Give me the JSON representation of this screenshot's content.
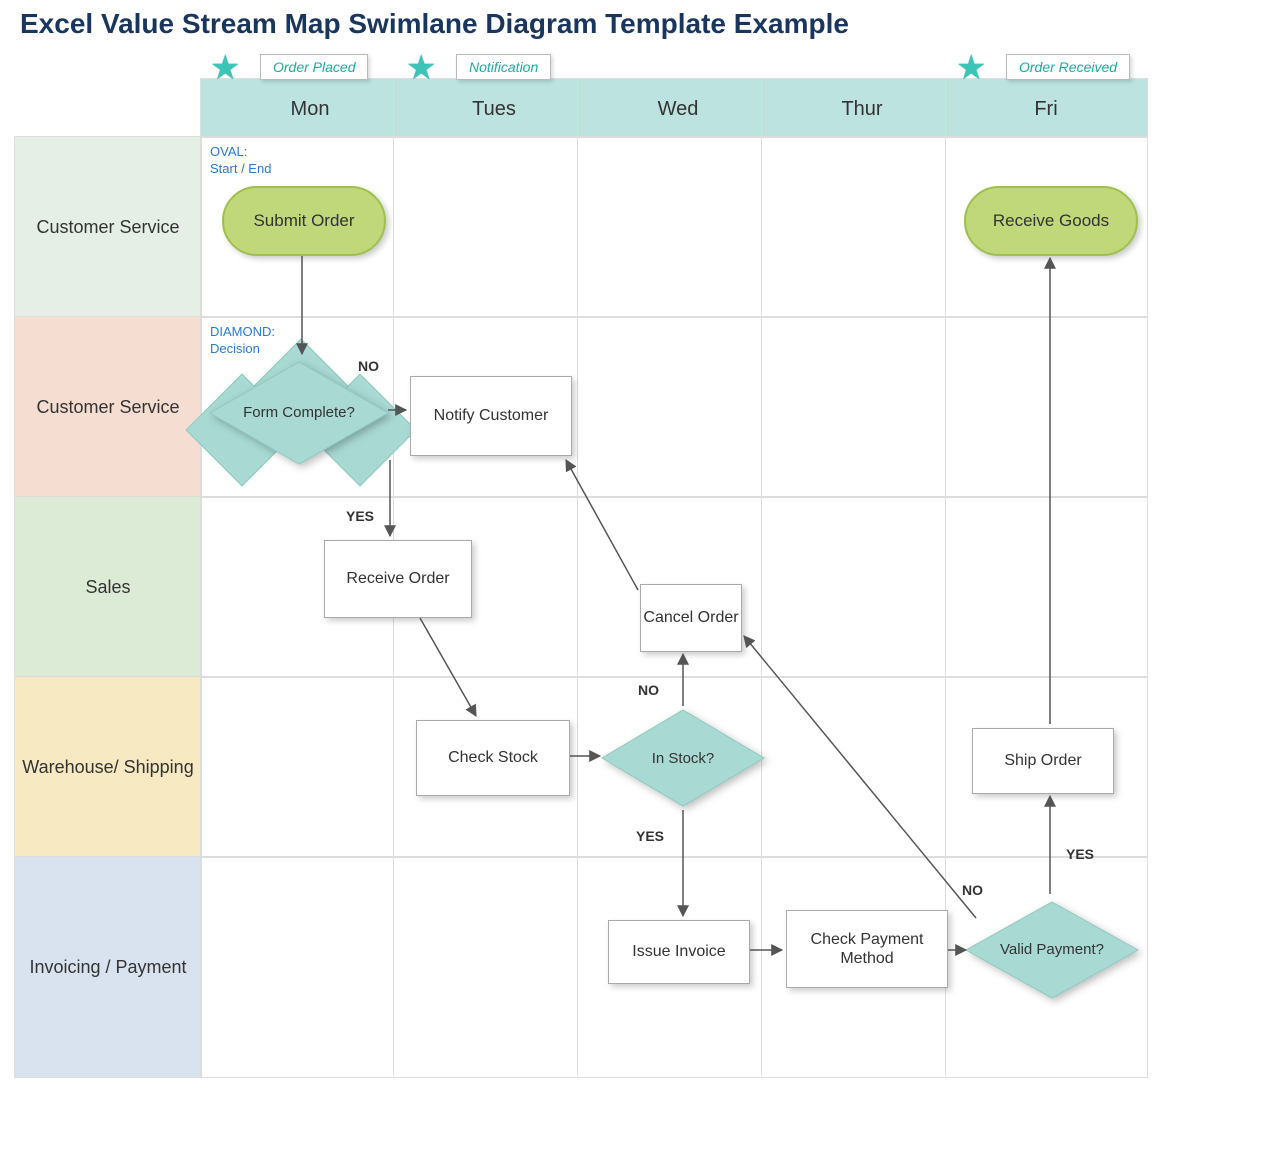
{
  "title": "Excel Value Stream Map Swimlane Diagram Template Example",
  "days": [
    "Mon",
    "Tues",
    "Wed",
    "Thur",
    "Fri"
  ],
  "milestones": [
    {
      "label": "Order Placed"
    },
    {
      "label": "Notification"
    },
    {
      "label": "Order Received"
    }
  ],
  "lanes": [
    {
      "name": "Customer Service"
    },
    {
      "name": "Customer Service"
    },
    {
      "name": "Sales"
    },
    {
      "name": "Warehouse/ Shipping"
    },
    {
      "name": "Invoicing / Payment"
    }
  ],
  "annotations": {
    "oval": "OVAL:\nStart / End",
    "diamond": "DIAMOND:\nDecision"
  },
  "nodes": {
    "submit_order": "Submit Order",
    "receive_goods": "Receive Goods",
    "form_complete": "Form Complete?",
    "notify_customer": "Notify Customer",
    "receive_order": "Receive Order",
    "check_stock": "Check Stock",
    "in_stock": "In Stock?",
    "cancel_order": "Cancel Order",
    "ship_order": "Ship Order",
    "issue_invoice": "Issue Invoice",
    "check_payment": "Check Payment Method",
    "valid_payment": "Valid Payment?"
  },
  "edge_labels": {
    "no1": "NO",
    "yes1": "YES",
    "no2": "NO",
    "yes2": "YES",
    "no3": "NO",
    "yes3": "YES"
  },
  "chart_data": {
    "type": "swimlane-flowchart",
    "columns": [
      "Mon",
      "Tues",
      "Wed",
      "Thur",
      "Fri"
    ],
    "milestones": [
      {
        "label": "Order Placed",
        "column": "Mon"
      },
      {
        "label": "Notification",
        "column": "Tues"
      },
      {
        "label": "Order Received",
        "column": "Fri"
      }
    ],
    "lanes": [
      "Customer Service",
      "Customer Service",
      "Sales",
      "Warehouse/ Shipping",
      "Invoicing / Payment"
    ],
    "nodes": [
      {
        "id": "submit_order",
        "label": "Submit Order",
        "shape": "terminator",
        "lane": 0,
        "column": "Mon"
      },
      {
        "id": "form_complete",
        "label": "Form Complete?",
        "shape": "decision",
        "lane": 1,
        "column": "Mon"
      },
      {
        "id": "notify_customer",
        "label": "Notify Customer",
        "shape": "process",
        "lane": 1,
        "column": "Tues"
      },
      {
        "id": "receive_order",
        "label": "Receive Order",
        "shape": "process",
        "lane": 2,
        "column": "Mon/Tues"
      },
      {
        "id": "check_stock",
        "label": "Check Stock",
        "shape": "process",
        "lane": 3,
        "column": "Tues"
      },
      {
        "id": "in_stock",
        "label": "In Stock?",
        "shape": "decision",
        "lane": 3,
        "column": "Wed"
      },
      {
        "id": "cancel_order",
        "label": "Cancel Order",
        "shape": "process",
        "lane": 2,
        "column": "Wed"
      },
      {
        "id": "issue_invoice",
        "label": "Issue Invoice",
        "shape": "process",
        "lane": 4,
        "column": "Wed"
      },
      {
        "id": "check_payment",
        "label": "Check Payment Method",
        "shape": "process",
        "lane": 4,
        "column": "Thur"
      },
      {
        "id": "valid_payment",
        "label": "Valid Payment?",
        "shape": "decision",
        "lane": 4,
        "column": "Fri"
      },
      {
        "id": "ship_order",
        "label": "Ship Order",
        "shape": "process",
        "lane": 3,
        "column": "Fri"
      },
      {
        "id": "receive_goods",
        "label": "Receive Goods",
        "shape": "terminator",
        "lane": 0,
        "column": "Fri"
      }
    ],
    "edges": [
      {
        "from": "submit_order",
        "to": "form_complete"
      },
      {
        "from": "form_complete",
        "to": "notify_customer",
        "label": "NO"
      },
      {
        "from": "form_complete",
        "to": "receive_order",
        "label": "YES"
      },
      {
        "from": "receive_order",
        "to": "check_stock"
      },
      {
        "from": "check_stock",
        "to": "in_stock"
      },
      {
        "from": "in_stock",
        "to": "cancel_order",
        "label": "NO"
      },
      {
        "from": "cancel_order",
        "to": "notify_customer"
      },
      {
        "from": "in_stock",
        "to": "issue_invoice",
        "label": "YES"
      },
      {
        "from": "issue_invoice",
        "to": "check_payment"
      },
      {
        "from": "check_payment",
        "to": "valid_payment"
      },
      {
        "from": "valid_payment",
        "to": "cancel_order",
        "label": "NO"
      },
      {
        "from": "valid_payment",
        "to": "ship_order",
        "label": "YES"
      },
      {
        "from": "ship_order",
        "to": "receive_goods"
      }
    ],
    "legend": [
      {
        "shape": "oval",
        "meaning": "Start / End"
      },
      {
        "shape": "diamond",
        "meaning": "Decision"
      }
    ]
  }
}
